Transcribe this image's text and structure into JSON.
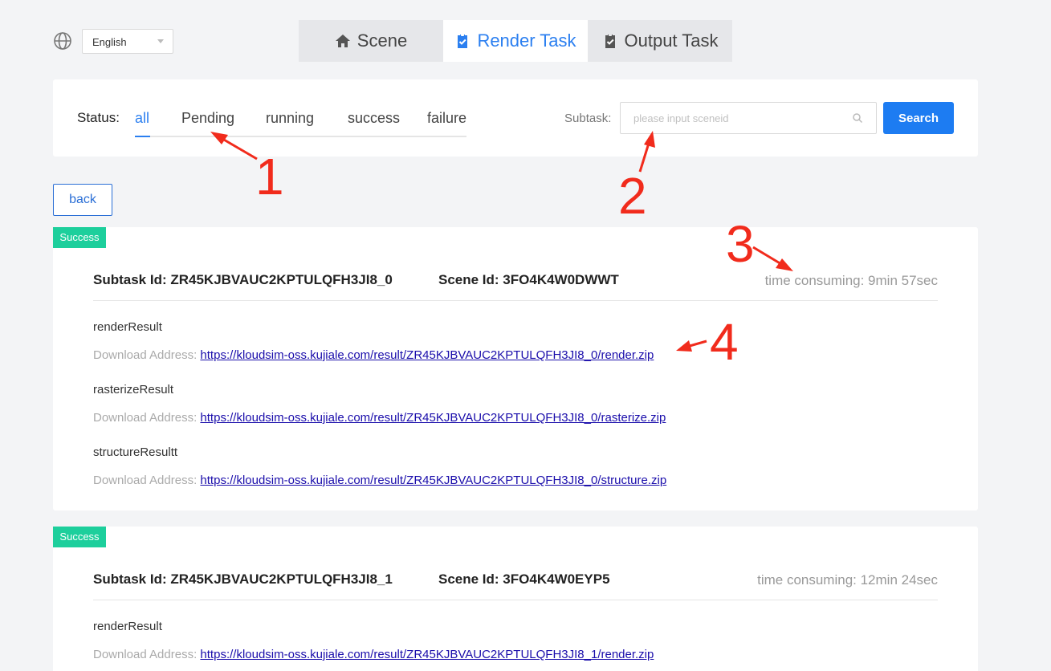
{
  "language": {
    "selected": "English"
  },
  "topnav": {
    "tabs": [
      "Scene",
      "Render Task",
      "Output Task"
    ],
    "active_index": 1
  },
  "filter": {
    "status_label": "Status:",
    "statuses": [
      "all",
      "Pending",
      "running",
      "success",
      "failure"
    ],
    "active_status": "all",
    "subtask_label": "Subtask:",
    "search_placeholder": "please input sceneid",
    "search_value": "",
    "search_button": "Search"
  },
  "back_button": "back",
  "annotations": [
    "1",
    "2",
    "3",
    "4"
  ],
  "results": [
    {
      "badge": "Success",
      "subtask_id": "Subtask Id: ZR45KJBVAUC2KPTULQFH3JI8_0",
      "scene_id": "Scene Id: 3FO4K4W0DWWT",
      "time": "time consuming: 9min 57sec",
      "items": [
        {
          "title": "renderResult",
          "label": "Download Address: ",
          "url": "https://kloudsim-oss.kujiale.com/result/ZR45KJBVAUC2KPTULQFH3JI8_0/render.zip"
        },
        {
          "title": "rasterizeResult",
          "label": "Download Address: ",
          "url": "https://kloudsim-oss.kujiale.com/result/ZR45KJBVAUC2KPTULQFH3JI8_0/rasterize.zip"
        },
        {
          "title": "structureResultt",
          "label": "Download Address: ",
          "url": "https://kloudsim-oss.kujiale.com/result/ZR45KJBVAUC2KPTULQFH3JI8_0/structure.zip"
        }
      ]
    },
    {
      "badge": "Success",
      "subtask_id": "Subtask Id: ZR45KJBVAUC2KPTULQFH3JI8_1",
      "scene_id": "Scene Id: 3FO4K4W0EYP5",
      "time": "time consuming: 12min 24sec",
      "items": [
        {
          "title": "renderResult",
          "label": "Download Address: ",
          "url": "https://kloudsim-oss.kujiale.com/result/ZR45KJBVAUC2KPTULQFH3JI8_1/render.zip"
        }
      ]
    }
  ]
}
